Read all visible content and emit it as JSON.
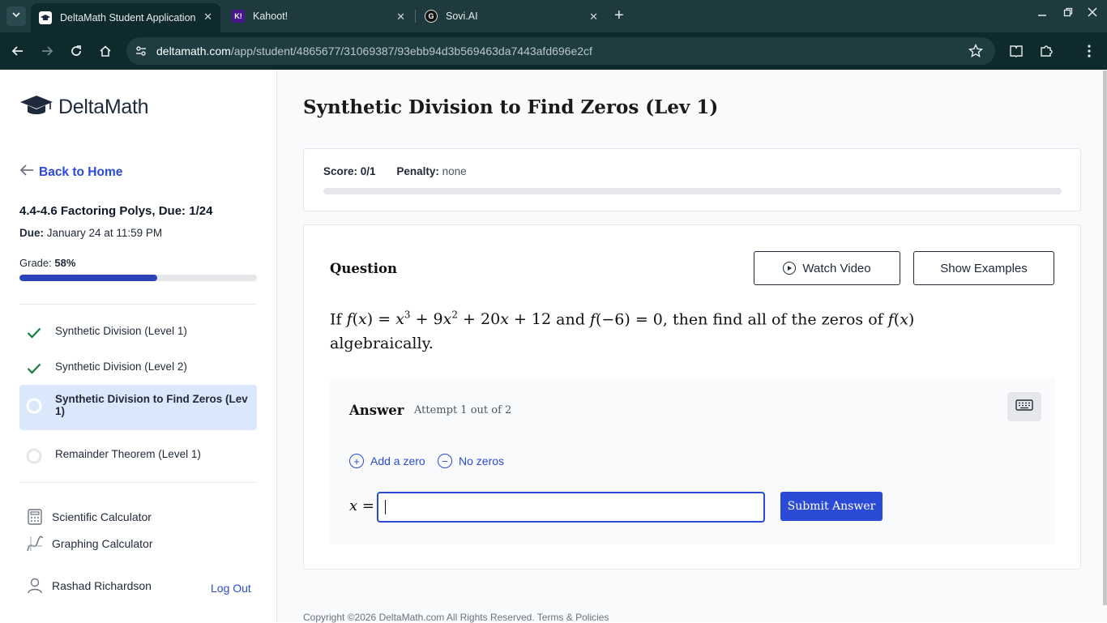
{
  "browser": {
    "tabs": [
      {
        "title": "DeltaMath Student Application",
        "active": true
      },
      {
        "title": "Kahoot!",
        "active": false,
        "favicon_text": "K!"
      },
      {
        "title": "Sovi.AI",
        "active": false
      }
    ],
    "url_host": "deltamath.com",
    "url_path": "/app/student/4865677/31069387/93ebb94d3b569463da7443afd696e2cf"
  },
  "sidebar": {
    "logo_text": "DeltaMath",
    "back_label": "Back to Home",
    "assignment_title": "4.4-4.6 Factoring Polys, Due: 1/24",
    "due_label": "Due:",
    "due_value": "January 24 at 11:59 PM",
    "grade_label": "Grade:",
    "grade_value": "58%",
    "grade_fraction": 0.58,
    "problems": [
      {
        "label": "Synthetic Division (Level 1)",
        "status": "complete"
      },
      {
        "label": "Synthetic Division (Level 2)",
        "status": "complete"
      },
      {
        "label": "Synthetic Division to Find Zeros (Lev 1)",
        "status": "current"
      },
      {
        "label": "Remainder Theorem (Level 1)",
        "status": "incomplete"
      }
    ],
    "tools": [
      {
        "label": "Scientific Calculator",
        "icon": "calculator-icon"
      },
      {
        "label": "Graphing Calculator",
        "icon": "graph-icon"
      }
    ],
    "user_name": "Rashad Richardson",
    "logout_label": "Log Out"
  },
  "main": {
    "title": "Synthetic Division to Find Zeros (Lev 1)",
    "score_label": "Score:",
    "score_value": "0/1",
    "penalty_label": "Penalty:",
    "penalty_value": "none",
    "question_label": "Question",
    "watch_video_label": "Watch Video",
    "show_examples_label": "Show Examples",
    "answer_label": "Answer",
    "attempt_text": "Attempt 1 out of 2",
    "add_zero_label": "Add a zero",
    "no_zeros_label": "No zeros",
    "input_value": "",
    "submit_label": "Submit Answer",
    "footer_text": "Copyright ©2026 DeltaMath.com All Rights Reserved.",
    "footer_link": "Terms & Policies"
  },
  "colors": {
    "accent": "#2b4bd7",
    "chrome_dark": "#0f2a2d",
    "check_green": "#15803d"
  }
}
